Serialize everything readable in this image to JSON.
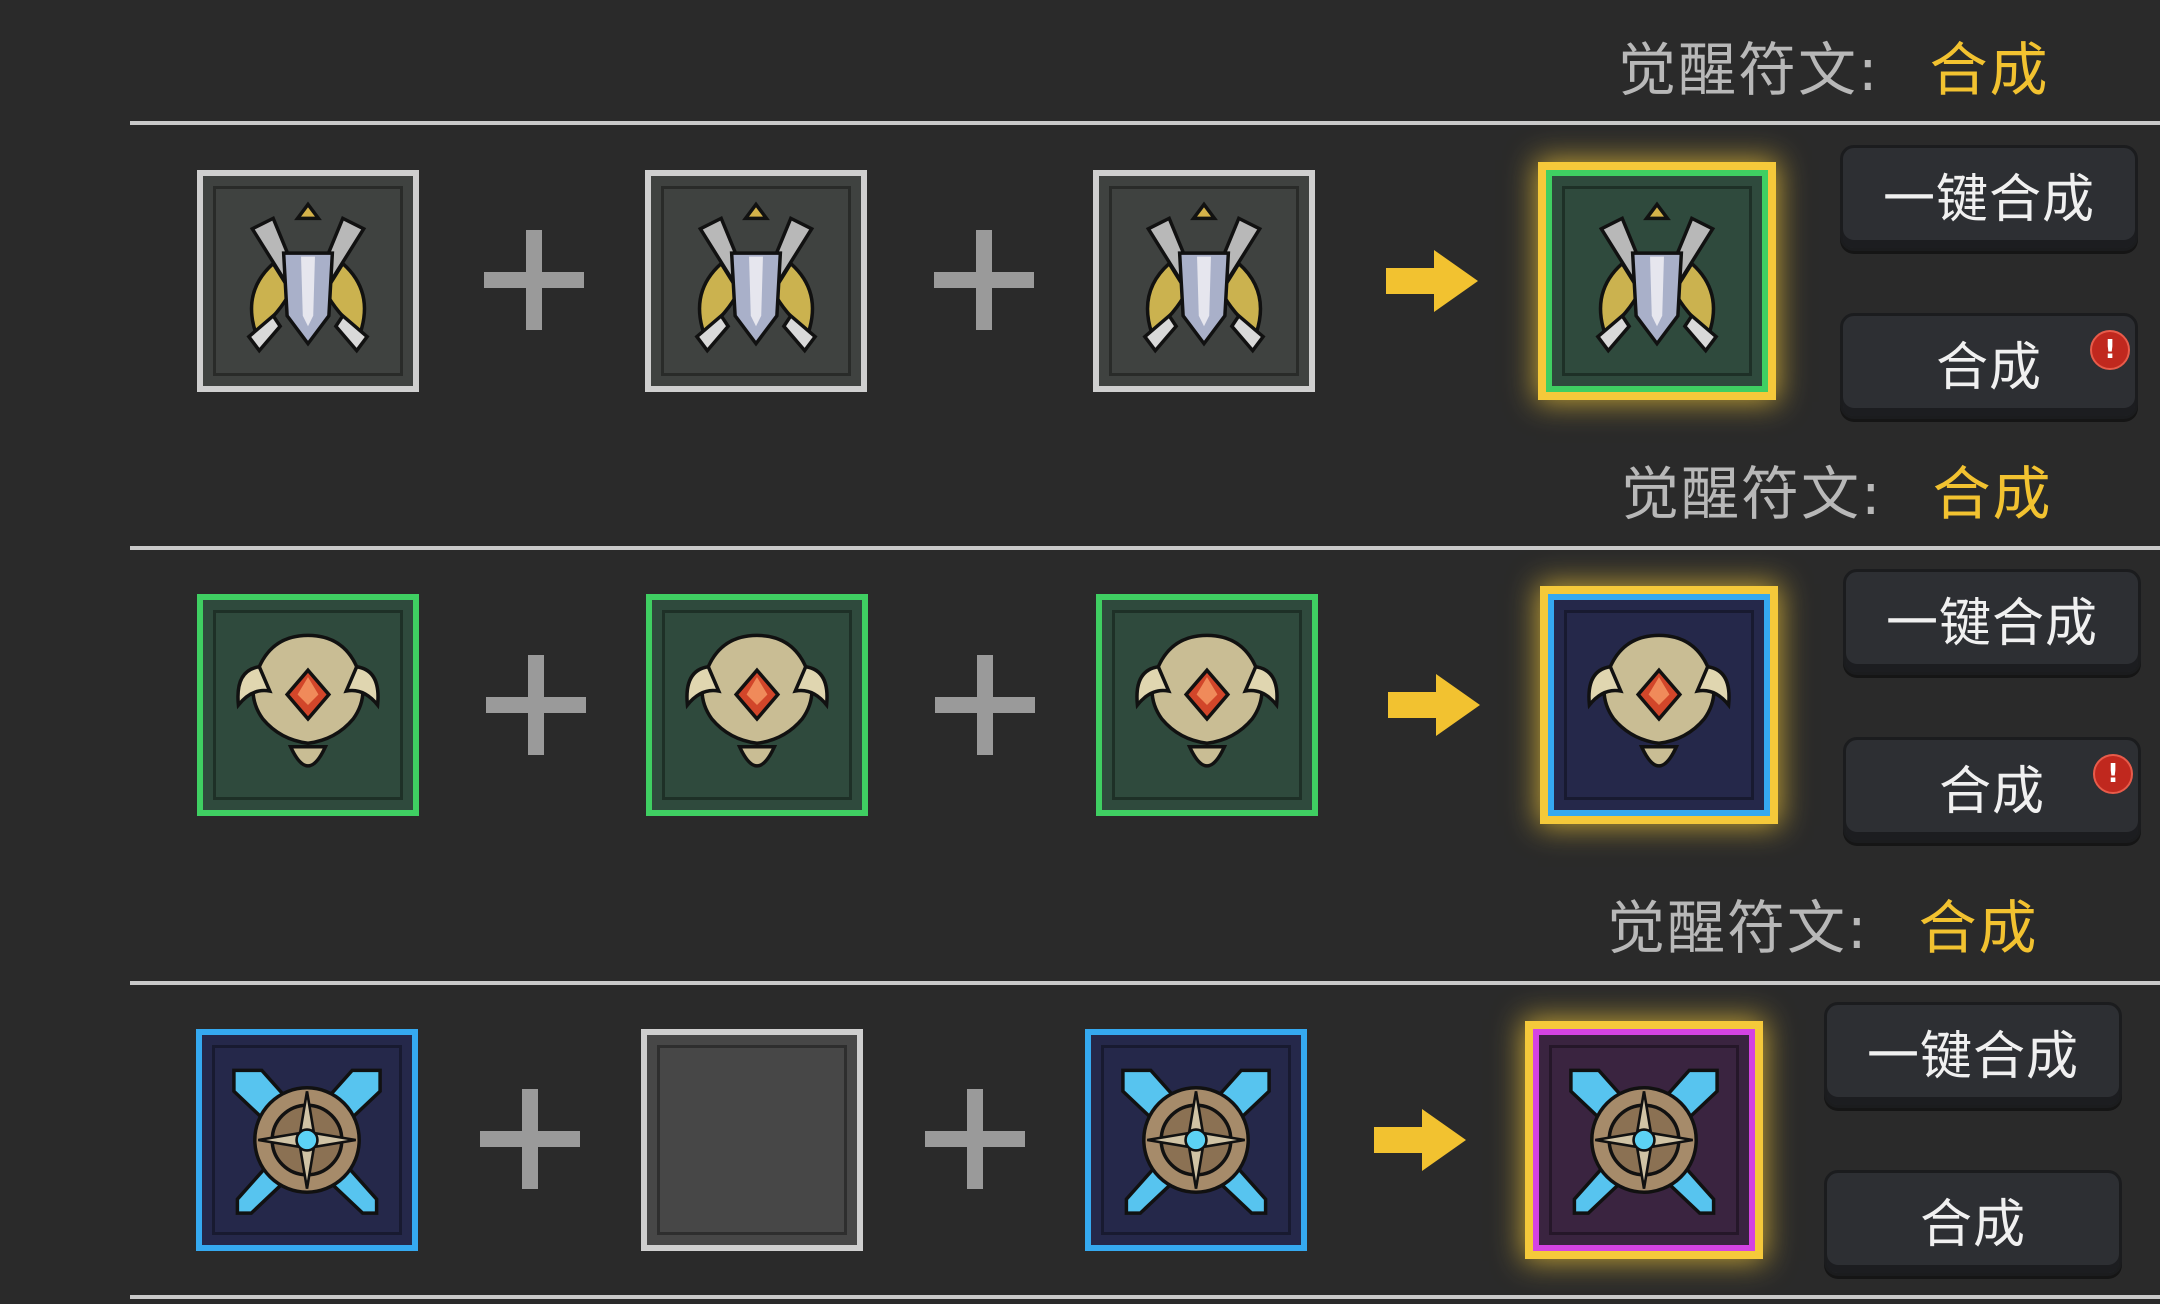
{
  "sections": [
    {
      "header_label": "觉醒符文:",
      "header_action": "合成",
      "one_click_label": "一键合成",
      "synth_label": "合成",
      "has_alert": true,
      "alert_glyph": "!",
      "input_slots": [
        {
          "rarity": "gray",
          "item": "winged-sword-shield-icon"
        },
        {
          "rarity": "gray",
          "item": "winged-sword-shield-icon"
        },
        {
          "rarity": "gray",
          "item": "winged-sword-shield-icon"
        }
      ],
      "result_slot": {
        "rarity": "green",
        "item": "winged-sword-shield-icon"
      }
    },
    {
      "header_label": "觉醒符文:",
      "header_action": "合成",
      "one_click_label": "一键合成",
      "synth_label": "合成",
      "has_alert": true,
      "alert_glyph": "!",
      "input_slots": [
        {
          "rarity": "green",
          "item": "horned-crest-ruby-icon"
        },
        {
          "rarity": "green",
          "item": "horned-crest-ruby-icon"
        },
        {
          "rarity": "green",
          "item": "horned-crest-ruby-icon"
        }
      ],
      "result_slot": {
        "rarity": "blue",
        "item": "horned-crest-ruby-icon"
      }
    },
    {
      "header_label": "觉醒符文:",
      "header_action": "合成",
      "one_click_label": "一键合成",
      "synth_label": "合成",
      "has_alert": false,
      "input_slots": [
        {
          "rarity": "blue",
          "item": "crossed-blades-shield-icon"
        },
        {
          "rarity": "empty",
          "item": "empty-slot"
        },
        {
          "rarity": "blue",
          "item": "crossed-blades-shield-icon"
        }
      ],
      "result_slot": {
        "rarity": "purple",
        "item": "crossed-blades-shield-icon"
      }
    }
  ],
  "colors": {
    "background": "#2a2a2a",
    "header_label": "#b8b8b8",
    "header_action": "#f2c230",
    "result_glow": "#f5c93a",
    "rarity_gray": "#cfcfcf",
    "rarity_green": "#3fcf62",
    "rarity_blue": "#35a9f0",
    "rarity_purple": "#d443e3",
    "alert_badge": "#c0281e"
  },
  "icons": {
    "plus": "plus-icon",
    "arrow": "arrow-right-icon"
  }
}
